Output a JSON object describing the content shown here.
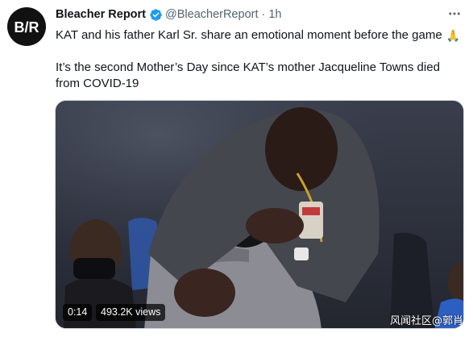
{
  "tweet": {
    "author_name": "Bleacher Report",
    "handle": "@BleacherReport",
    "separator": "·",
    "time": "1h",
    "avatar_text": "B/R",
    "more_icon": "more-dots-icon",
    "verified_icon": "verified-badge-icon",
    "text_line1": "KAT and his father Karl Sr. share an emotional moment before the game",
    "text_line1_emoji": "🙏",
    "text_para2": "It’s the second Mother’s Day since KAT’s mother Jacqueline Towns died from COVID-19"
  },
  "video": {
    "duration": "0:14",
    "views": "493.2K views"
  },
  "watermark": "风闻社区@郭肖",
  "colors": {
    "verified_blue": "#1d9bf0",
    "muted_text": "#536471",
    "primary_text": "#0f1419"
  }
}
